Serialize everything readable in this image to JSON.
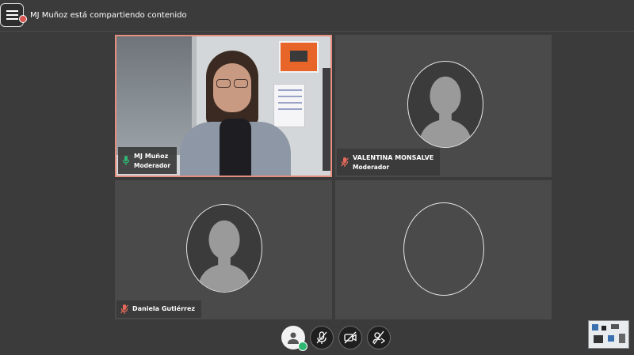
{
  "topbar": {
    "share_status": "MJ Muñoz está compartiendo contenido"
  },
  "tiles": [
    {
      "name": "MJ Muñoz",
      "role": "Moderador",
      "active": true,
      "has_video": true
    },
    {
      "name": "VALENTINA MONSALVE",
      "role": "Moderador",
      "active": false,
      "has_video": false
    },
    {
      "name": "Daniela Gutiérrez",
      "role": "",
      "active": false,
      "has_video": false
    },
    {
      "name": "",
      "role": "",
      "active": false,
      "has_video": false
    }
  ],
  "controls": [
    {
      "icon": "user-icon",
      "status": "connected"
    },
    {
      "icon": "mic-off-icon"
    },
    {
      "icon": "camera-off-icon"
    },
    {
      "icon": "share-off-icon"
    }
  ],
  "colors": {
    "background": "#3b3b3b",
    "tile": "#4a4a4a",
    "active_border": "#e48e7f",
    "status_ok": "#2eb872",
    "mic_badge": "#e86a5a"
  }
}
